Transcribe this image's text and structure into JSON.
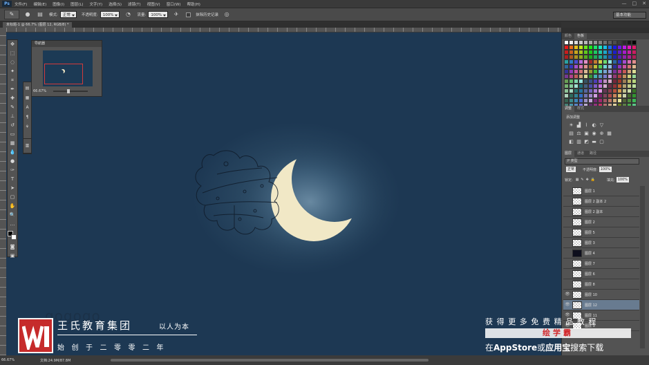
{
  "app": {
    "logo": "Ps"
  },
  "menubar": {
    "items": [
      "文件(F)",
      "编辑(E)",
      "图像(I)",
      "图层(L)",
      "文字(Y)",
      "选择(S)",
      "滤镜(T)",
      "视图(V)",
      "窗口(W)",
      "帮助(H)"
    ]
  },
  "window_controls": {
    "minimize": "—",
    "restore": "□",
    "close": "✕"
  },
  "options": {
    "mode_label": "模式:",
    "mode_value": "正常",
    "opacity_label": "不透明度:",
    "opacity_value": "100%",
    "flow_label": "流量:",
    "flow_value": "100%",
    "history_label": "抹除历史记录",
    "workspace": "基本功能"
  },
  "document_tab": {
    "title": "未标题-1 @ 66.7% (图层 12, RGB/8) *"
  },
  "navigator": {
    "title": "导航器",
    "zoom": "66.67%"
  },
  "watermark_text": "gogogo",
  "right_panel": {
    "swatch_tabs": [
      "颜色",
      "色板"
    ],
    "adj_tabs": [
      "调整",
      "样式"
    ],
    "adj_title": "添加调整",
    "layer_tabs": [
      "图层",
      "通道",
      "路径"
    ],
    "filter_label": "P 类型",
    "blend_mode": "正常",
    "opacity_label": "不透明度:",
    "opacity_value": "100%",
    "lock_label": "锁定:",
    "fill_label": "填充:",
    "fill_value": "100%"
  },
  "layers": [
    {
      "name": "图层 1",
      "dark": false,
      "selected": false
    },
    {
      "name": "图层 2 副本 2",
      "dark": false,
      "selected": false
    },
    {
      "name": "图层 2 副本",
      "dark": false,
      "selected": false
    },
    {
      "name": "图层 2",
      "dark": false,
      "selected": false
    },
    {
      "name": "图层 5",
      "dark": false,
      "selected": false
    },
    {
      "name": "图层 3",
      "dark": false,
      "selected": false
    },
    {
      "name": "图层 4",
      "dark": true,
      "selected": false
    },
    {
      "name": "图层 7",
      "dark": false,
      "selected": false
    },
    {
      "name": "图层 6",
      "dark": false,
      "selected": false
    },
    {
      "name": "图层 8",
      "dark": false,
      "selected": false
    },
    {
      "name": "图层 10",
      "dark": false,
      "selected": false
    },
    {
      "name": "图层 12",
      "dark": false,
      "selected": true
    },
    {
      "name": "图层 11",
      "dark": false,
      "selected": false
    },
    {
      "name": "图层 9",
      "dark": false,
      "selected": false
    }
  ],
  "status": {
    "zoom": "66.67%",
    "doc": "文档:24.9M/87.8M"
  },
  "branding": {
    "name": "王氏教育集团",
    "slogan": "以人为本",
    "sub": "始创于二零零二年"
  },
  "promo": {
    "line1": "获得更多免费精品教程",
    "line2": "绘学霸",
    "line3_pre": "在",
    "line3_store": "AppStore",
    "line3_mid": "或",
    "line3_app": "应用宝",
    "line3_post": "搜索下载"
  },
  "colors": {
    "canvas_bg": "#1d3853",
    "moon": "#f1e8c6",
    "brand_red": "#c62b2b",
    "promo_red": "#d2282b"
  }
}
